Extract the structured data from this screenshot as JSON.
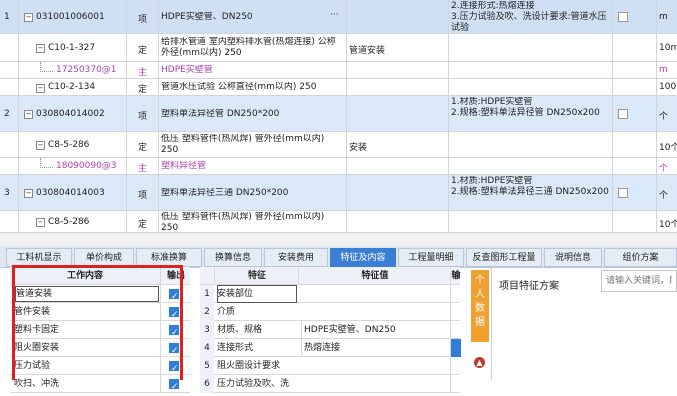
{
  "top_rows": [
    {
      "no": "1",
      "code": "031001006001",
      "type": "项",
      "name": "HDPE实壁管、DN250",
      "more": "···",
      "feature": "2.连接形式:热熔连接\n3.压力试验及吹、洗设计要求:管道水压试验",
      "unit": "m",
      "kind": "main"
    },
    {
      "code": "C10-1-327",
      "type": "定",
      "name": "给排水管道 室内塑料排水管(热熔连接) 公称外径(mm以内) 250",
      "spec": "管道安装",
      "unit": "10m",
      "kind": "sub"
    },
    {
      "code": "17250370@1",
      "type": "主",
      "name": "HDPE实壁管",
      "unit": "m",
      "kind": "mat"
    },
    {
      "code": "C10-2-134",
      "type": "定",
      "name": "管道水压试验 公称直径(mm以内) 250",
      "unit": "100m",
      "kind": "sub"
    },
    {
      "no": "2",
      "code": "030804014002",
      "type": "项",
      "name": "塑料单法异径管 DN250*200",
      "feature": "1.材质:HDPE实壁管\n2.规格:塑料单法异径管 DN250x200",
      "unit": "个",
      "kind": "main"
    },
    {
      "code": "C8-5-286",
      "type": "定",
      "name": "低压 塑料管件(热风焊) 管外径(mm以内) 250",
      "spec": "安装",
      "unit": "10个",
      "kind": "sub"
    },
    {
      "code": "18090090@3",
      "type": "主",
      "name": "塑料异径管",
      "unit": "个",
      "kind": "mat"
    },
    {
      "no": "3",
      "code": "030804014003",
      "type": "项",
      "name": "塑料单法异径三通 DN250*200",
      "feature": "1.材质:HDPE实壁管\n2.规格:塑料单法异径三通 DN250x200",
      "unit": "个",
      "kind": "main"
    },
    {
      "code": "C8-5-286",
      "type": "定",
      "name": "低压 塑料管件(热风焊) 管外径(mm以内) 250",
      "unit": "10个",
      "kind": "sub"
    }
  ],
  "tabs": [
    "工料机显示",
    "单价构成",
    "标准换算",
    "换算信息",
    "安装费用",
    "特征及内容",
    "工程量明细",
    "反查图形工程量",
    "说明信息",
    "组价方案"
  ],
  "active_tab": "特征及内容",
  "work_table": {
    "header_content": "工作内容",
    "header_output": "输出",
    "rows": [
      {
        "label": "管道安装",
        "checked": true
      },
      {
        "label": "管件安装",
        "checked": true
      },
      {
        "label": "塑料卡固定",
        "checked": true
      },
      {
        "label": "阻火圈安装",
        "checked": true
      },
      {
        "label": "压力试验",
        "checked": true
      },
      {
        "label": "吹扫、冲洗",
        "checked": true
      }
    ]
  },
  "feature_table": {
    "header_feature": "特征",
    "header_value": "特征值",
    "header_out": "输",
    "rows": [
      {
        "no": "1",
        "name": "安装部位",
        "value": ""
      },
      {
        "no": "2",
        "name": "介质",
        "value": ""
      },
      {
        "no": "3",
        "name": "材质、规格",
        "value": "HDPE实壁管、DN250"
      },
      {
        "no": "4",
        "name": "连接形式",
        "value": "热熔连接"
      },
      {
        "no": "5",
        "name": "阻火圈设计要求",
        "value": ""
      },
      {
        "no": "6",
        "name": "压力试验及吹、洗",
        "value": ""
      }
    ]
  },
  "side_panel": {
    "vertical_label": "个人数据",
    "title": "项目特征方案",
    "search_placeholder": "请输入关键词，后"
  },
  "colors": {
    "main_row": "#dbe8f7",
    "accent": "#3b7fd4",
    "highlight_box": "#e02020",
    "side_tab": "#f0a030"
  }
}
